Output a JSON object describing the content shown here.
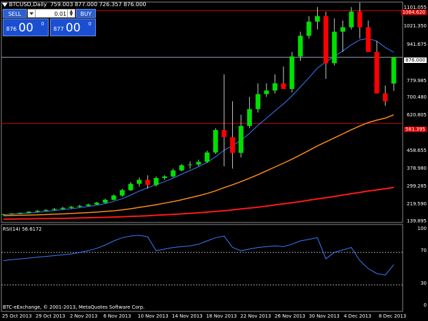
{
  "header": {
    "symbol": "BTCUSD,Daily",
    "ohlc": "759.003 877.000 726.357 876.000"
  },
  "trade_panel": {
    "sell_label": "SELL",
    "buy_label": "BUY",
    "lot": "0.01",
    "sell_small": "876",
    "sell_big": "00",
    "sell_sup": "0",
    "buy_small": "877",
    "buy_big": "00",
    "buy_sup": "0"
  },
  "price_axis": [
    "1101.055",
    "1021.350",
    "941.675",
    "860.990",
    "779.985",
    "700.480",
    "620.805",
    "540.490",
    "458.655",
    "378.980",
    "299.285",
    "219.590",
    "139.895"
  ],
  "price_markers": {
    "top_red": "1084.620",
    "current": "876.000",
    "bottom_red": "581.395"
  },
  "rsi": {
    "label": "RSI(14) 56.6172",
    "levels": [
      "100",
      "70",
      "30",
      "0"
    ]
  },
  "date_axis": [
    "25 Oct 2013",
    "29 Oct 2013",
    "2 Nov 2013",
    "6 Nov 2013",
    "10 Nov 2013",
    "14 Nov 2013",
    "18 Nov 2013",
    "22 Nov 2013",
    "26 Nov 2013",
    "30 Nov 2013",
    "4 Dec 2013",
    "8 Dec 2013"
  ],
  "footer": {
    "copyright": "BTC-eExchange, © 2001-2013, MetaQuotes Software Corp."
  },
  "colors": {
    "bull": "#00e000",
    "bear": "#ff0000",
    "ma_fast": "#3b7dff",
    "ma_mid": "#ff8c1a",
    "ma_slow": "#ff1a1a",
    "rsi_line": "#3b7dff"
  },
  "chart_data": {
    "type": "candlestick",
    "categories": [
      "Oct 24",
      "Oct 25",
      "Oct 26",
      "Oct 27",
      "Oct 28",
      "Oct 29",
      "Oct 30",
      "Oct 31",
      "Nov 1",
      "Nov 2",
      "Nov 3",
      "Nov 4",
      "Nov 5",
      "Nov 6",
      "Nov 7",
      "Nov 8",
      "Nov 9",
      "Nov 10",
      "Nov 11",
      "Nov 12",
      "Nov 13",
      "Nov 14",
      "Nov 15",
      "Nov 16",
      "Nov 17",
      "Nov 18",
      "Nov 19",
      "Nov 20",
      "Nov 21",
      "Nov 22",
      "Nov 23",
      "Nov 24",
      "Nov 25",
      "Nov 26",
      "Nov 27",
      "Nov 28",
      "Nov 29",
      "Nov 30",
      "Dec 1",
      "Dec 2",
      "Dec 3",
      "Dec 4",
      "Dec 5",
      "Dec 6",
      "Dec 7",
      "Dec 8",
      "Dec 9"
    ],
    "candles": [
      [
        175,
        178,
        172,
        177
      ],
      [
        177,
        181,
        175,
        180
      ],
      [
        180,
        184,
        178,
        183
      ],
      [
        183,
        189,
        181,
        188
      ],
      [
        188,
        195,
        185,
        192
      ],
      [
        192,
        198,
        190,
        196
      ],
      [
        196,
        204,
        193,
        200
      ],
      [
        200,
        209,
        197,
        205
      ],
      [
        205,
        213,
        202,
        210
      ],
      [
        210,
        218,
        207,
        214
      ],
      [
        214,
        224,
        212,
        220
      ],
      [
        220,
        232,
        218,
        228
      ],
      [
        228,
        246,
        225,
        241
      ],
      [
        241,
        265,
        238,
        260
      ],
      [
        260,
        290,
        255,
        284
      ],
      [
        284,
        320,
        280,
        312
      ],
      [
        312,
        340,
        300,
        330
      ],
      [
        330,
        350,
        290,
        307
      ],
      [
        307,
        345,
        300,
        338
      ],
      [
        338,
        350,
        330,
        345
      ],
      [
        345,
        380,
        340,
        372
      ],
      [
        372,
        400,
        368,
        395
      ],
      [
        395,
        412,
        380,
        398
      ],
      [
        398,
        420,
        390,
        410
      ],
      [
        410,
        460,
        405,
        452
      ],
      [
        452,
        560,
        445,
        552
      ],
      [
        552,
        800,
        390,
        520
      ],
      [
        520,
        680,
        380,
        450
      ],
      [
        450,
        620,
        430,
        570
      ],
      [
        570,
        700,
        560,
        645
      ],
      [
        645,
        760,
        630,
        712
      ],
      [
        712,
        760,
        700,
        728
      ],
      [
        728,
        800,
        715,
        760
      ],
      [
        760,
        835,
        740,
        735
      ],
      [
        735,
        900,
        720,
        880
      ],
      [
        880,
        990,
        860,
        972
      ],
      [
        972,
        1060,
        960,
        1035
      ],
      [
        1035,
        1100,
        1000,
        1060
      ],
      [
        1060,
        1080,
        780,
        850
      ],
      [
        850,
        1050,
        840,
        990
      ],
      [
        990,
        1040,
        900,
        1010
      ],
      [
        1010,
        1100,
        1000,
        1080
      ],
      [
        1080,
        1120,
        960,
        1010
      ],
      [
        1010,
        1040,
        900,
        900
      ],
      [
        900,
        950,
        740,
        715
      ],
      [
        715,
        750,
        660,
        680
      ],
      [
        759,
        877,
        726,
        876
      ]
    ],
    "ma_fast": [
      175,
      177,
      179,
      182,
      185,
      189,
      193,
      197,
      201,
      206,
      211,
      217,
      224,
      234,
      246,
      262,
      280,
      295,
      308,
      322,
      337,
      355,
      372,
      388,
      408,
      433,
      462,
      482,
      507,
      537,
      573,
      604,
      637,
      668,
      704,
      744,
      785,
      828,
      856,
      880,
      905,
      932,
      954,
      960,
      948,
      920,
      898
    ],
    "ma_mid": [
      170,
      171,
      172,
      173,
      174,
      175,
      177,
      178,
      180,
      182,
      184,
      186,
      189,
      192,
      196,
      201,
      207,
      213,
      219,
      226,
      233,
      241,
      250,
      259,
      269,
      281,
      295,
      308,
      322,
      337,
      353,
      370,
      387,
      404,
      422,
      441,
      461,
      481,
      499,
      517,
      535,
      553,
      570,
      585,
      596,
      605,
      620
    ],
    "ma_slow": [
      155,
      155,
      156,
      156,
      157,
      157,
      158,
      158,
      159,
      160,
      161,
      162,
      163,
      164,
      165,
      167,
      168,
      170,
      172,
      174,
      176,
      178,
      181,
      183,
      186,
      189,
      192,
      196,
      200,
      204,
      208,
      213,
      218,
      223,
      228,
      233,
      239,
      245,
      250,
      256,
      262,
      268,
      274,
      280,
      285,
      290,
      296
    ],
    "rsi": [
      60,
      61,
      62,
      63,
      64,
      65,
      66,
      67,
      68,
      70,
      72,
      75,
      79,
      84,
      88,
      90,
      91,
      89,
      72,
      74,
      76,
      77,
      78,
      80,
      84,
      88,
      90,
      76,
      72,
      74,
      76,
      77,
      78,
      77,
      80,
      84,
      86,
      88,
      62,
      70,
      73,
      76,
      60,
      50,
      44,
      42,
      55
    ]
  }
}
